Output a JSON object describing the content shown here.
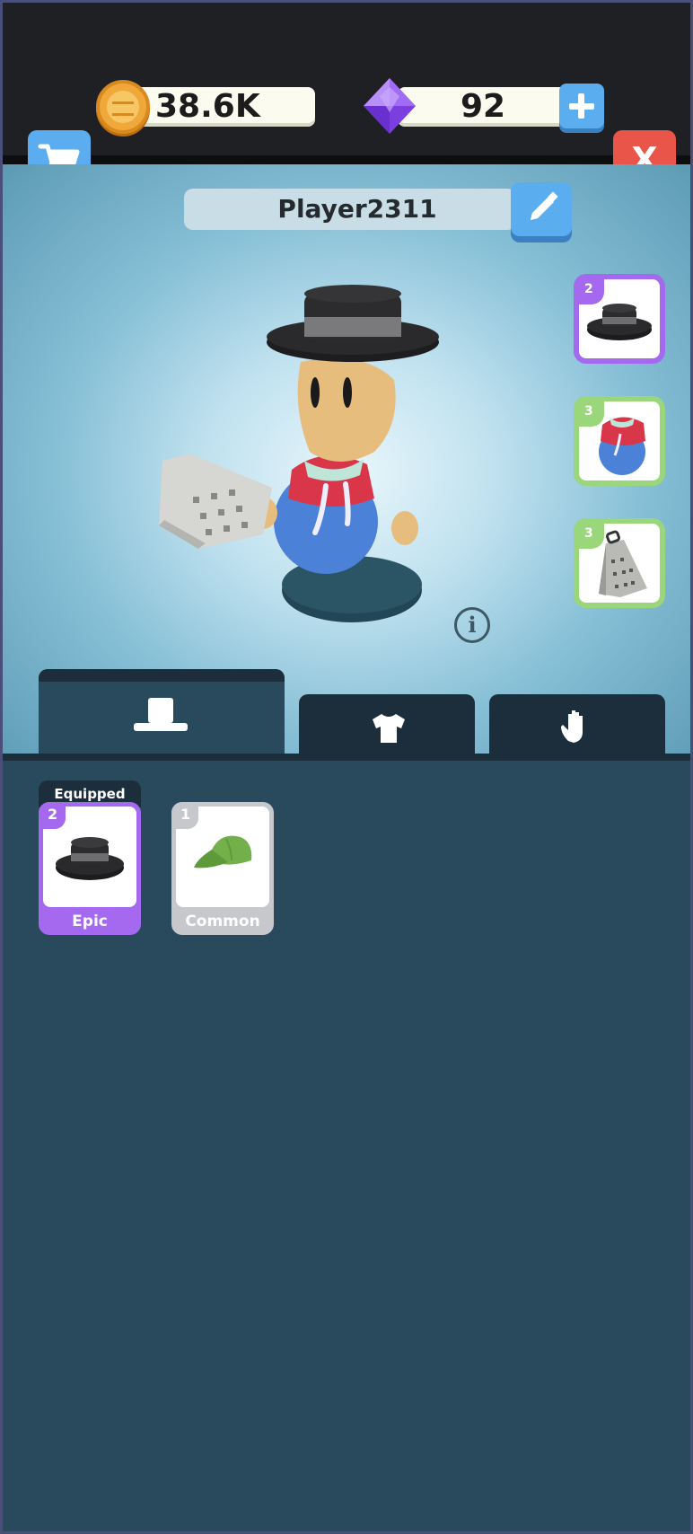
{
  "header": {
    "coins": "38.6K",
    "gems": "92",
    "cart_icon": "shopping-cart-icon",
    "add_gems_icon": "plus-icon",
    "close_label": "X"
  },
  "profile": {
    "player_name": "Player2311",
    "edit_icon": "pencil-icon",
    "info_label": "i"
  },
  "equipped_slots": [
    {
      "level": "2",
      "item": "black-hat",
      "rarity_color": "#a469ef"
    },
    {
      "level": "3",
      "item": "red-blue-hoodie",
      "rarity_color": "#9ad67a"
    },
    {
      "level": "3",
      "item": "cheese-grater",
      "rarity_color": "#9ad67a"
    }
  ],
  "tabs": [
    {
      "icon": "hat-icon",
      "active": true
    },
    {
      "icon": "shirt-icon",
      "active": false
    },
    {
      "icon": "hand-icon",
      "active": false
    }
  ],
  "inventory": {
    "equipped_label": "Equipped",
    "items": [
      {
        "level": "2",
        "rarity": "Epic",
        "item": "black-hat",
        "color": "#a469ef"
      },
      {
        "level": "1",
        "rarity": "Common",
        "item": "green-cap",
        "color": "#c6c8cc"
      }
    ]
  }
}
